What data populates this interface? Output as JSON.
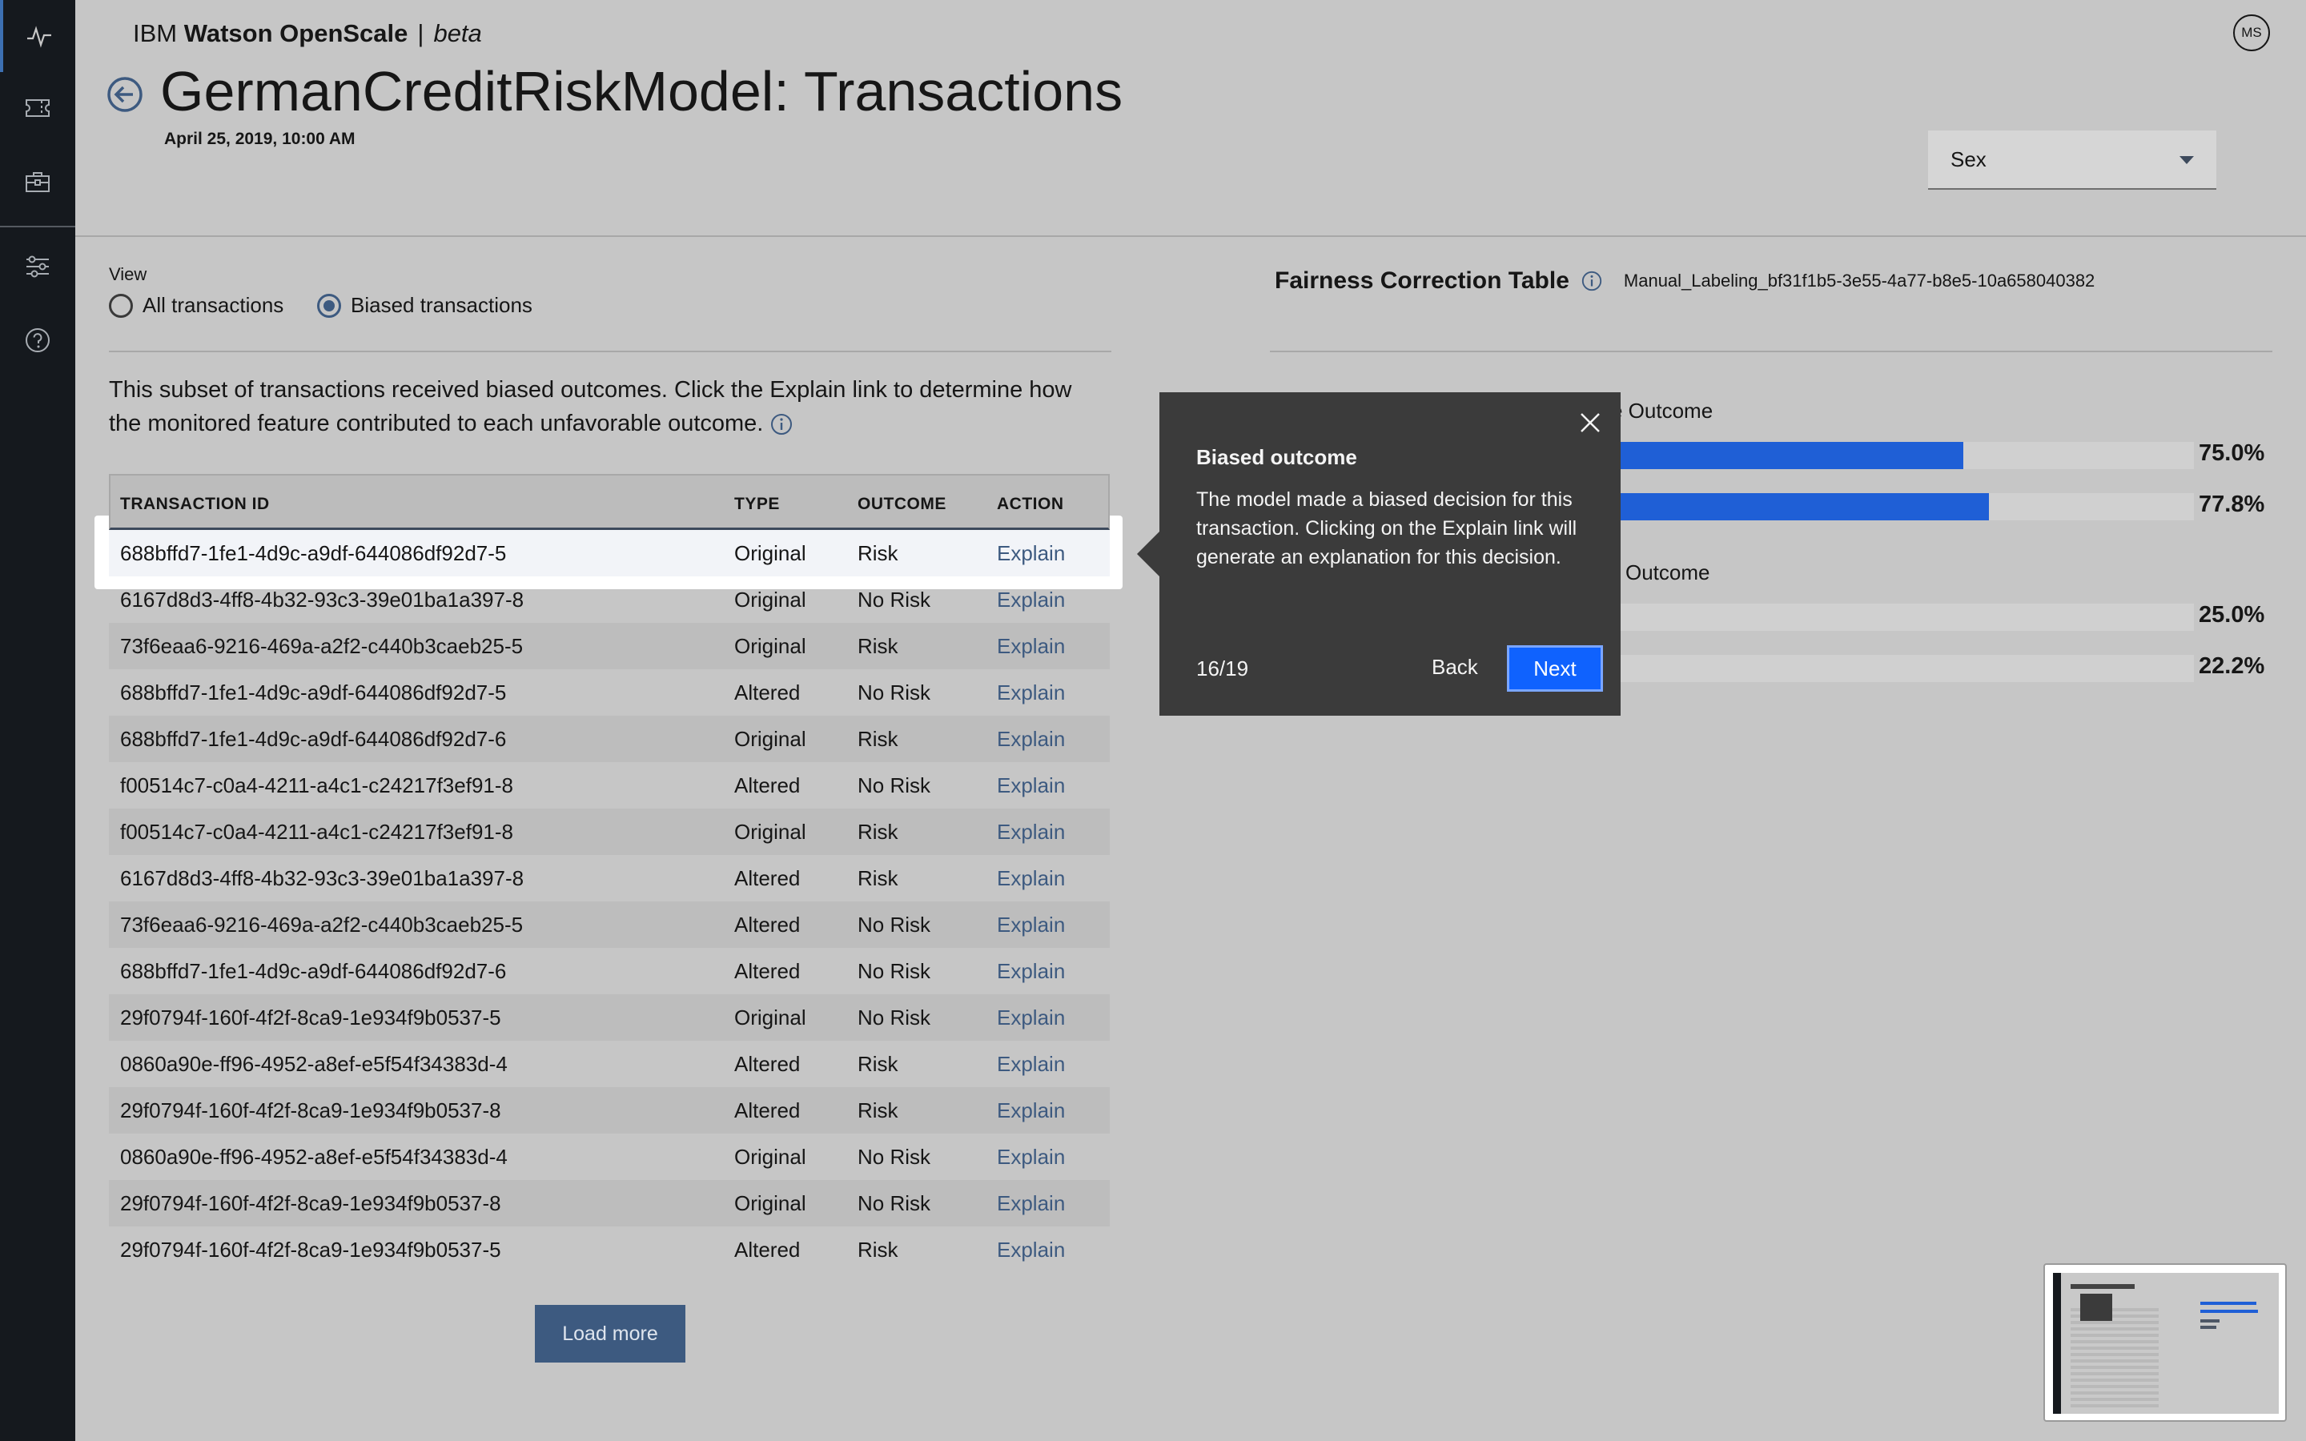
{
  "header": {
    "brand_normal": "IBM",
    "brand_bold": "Watson OpenScale",
    "brand_separator": "|",
    "brand_beta": "beta",
    "avatar_initials": "MS",
    "title": "GermanCreditRiskModel: Transactions",
    "date": "April 25, 2019, 10:00 AM",
    "dropdown_value": "Sex"
  },
  "sidebar": {
    "items": [
      {
        "icon": "activity-icon"
      },
      {
        "icon": "ticket-icon"
      },
      {
        "icon": "briefcase-icon"
      },
      {
        "icon": "settings-sliders-icon"
      },
      {
        "icon": "help-icon"
      }
    ]
  },
  "view": {
    "label": "View",
    "option_all": "All transactions",
    "option_biased": "Biased transactions",
    "selected": "Biased transactions"
  },
  "intro_text": "This subset of transactions received biased outcomes. Click the Explain link to determine how the monitored feature contributed to each unfavorable outcome.",
  "table": {
    "columns": [
      "TRANSACTION ID",
      "TYPE",
      "OUTCOME",
      "ACTION"
    ],
    "rows": [
      [
        "688bffd7-1fe1-4d9c-a9df-644086df92d7-5",
        "Original",
        "Risk",
        "Explain"
      ],
      [
        "6167d8d3-4ff8-4b32-93c3-39e01ba1a397-8",
        "Original",
        "No Risk",
        "Explain"
      ],
      [
        "73f6eaa6-9216-469a-a2f2-c440b3caeb25-5",
        "Original",
        "Risk",
        "Explain"
      ],
      [
        "688bffd7-1fe1-4d9c-a9df-644086df92d7-5",
        "Altered",
        "No Risk",
        "Explain"
      ],
      [
        "688bffd7-1fe1-4d9c-a9df-644086df92d7-6",
        "Original",
        "Risk",
        "Explain"
      ],
      [
        "f00514c7-c0a4-4211-a4c1-c24217f3ef91-8",
        "Altered",
        "No Risk",
        "Explain"
      ],
      [
        "f00514c7-c0a4-4211-a4c1-c24217f3ef91-8",
        "Original",
        "Risk",
        "Explain"
      ],
      [
        "6167d8d3-4ff8-4b32-93c3-39e01ba1a397-8",
        "Altered",
        "Risk",
        "Explain"
      ],
      [
        "73f6eaa6-9216-469a-a2f2-c440b3caeb25-5",
        "Altered",
        "No Risk",
        "Explain"
      ],
      [
        "688bffd7-1fe1-4d9c-a9df-644086df92d7-6",
        "Altered",
        "No Risk",
        "Explain"
      ],
      [
        "29f0794f-160f-4f2f-8ca9-1e934f9b0537-5",
        "Original",
        "No Risk",
        "Explain"
      ],
      [
        "0860a90e-ff96-4952-a8ef-e5f54f34383d-4",
        "Altered",
        "Risk",
        "Explain"
      ],
      [
        "29f0794f-160f-4f2f-8ca9-1e934f9b0537-8",
        "Altered",
        "Risk",
        "Explain"
      ],
      [
        "0860a90e-ff96-4952-a8ef-e5f54f34383d-4",
        "Original",
        "No Risk",
        "Explain"
      ],
      [
        "29f0794f-160f-4f2f-8ca9-1e934f9b0537-8",
        "Original",
        "No Risk",
        "Explain"
      ],
      [
        "29f0794f-160f-4f2f-8ca9-1e934f9b0537-5",
        "Altered",
        "Risk",
        "Explain"
      ]
    ],
    "load_more": "Load more"
  },
  "fairness": {
    "title": "Fairness Correction Table",
    "model_id": "Manual_Labeling_bf31f1b5-3e55-4a77-b8e5-10a658040382",
    "group1_label": "e Outcome",
    "group2_label": "Outcome",
    "bars": [
      {
        "value": 75.0,
        "label": "75.0%",
        "color": "#1f5fd6"
      },
      {
        "value": 77.8,
        "label": "77.8%",
        "color": "#1f5fd6"
      },
      {
        "value": 25.0,
        "label": "25.0%",
        "color": "#4d5766"
      },
      {
        "value": 22.2,
        "label": "22.2%",
        "color": "#4d5766"
      }
    ]
  },
  "tour": {
    "title": "Biased outcome",
    "body": "The model made a biased decision for this transaction. Clicking on the Explain link will generate an explanation for this decision.",
    "step": "16/19",
    "back": "Back",
    "next": "Next"
  },
  "colors": {
    "accent": "#0f62fe",
    "link": "#3d5a80",
    "sidebar": "#15191e",
    "overlay_bg": "#c6c6c6"
  }
}
